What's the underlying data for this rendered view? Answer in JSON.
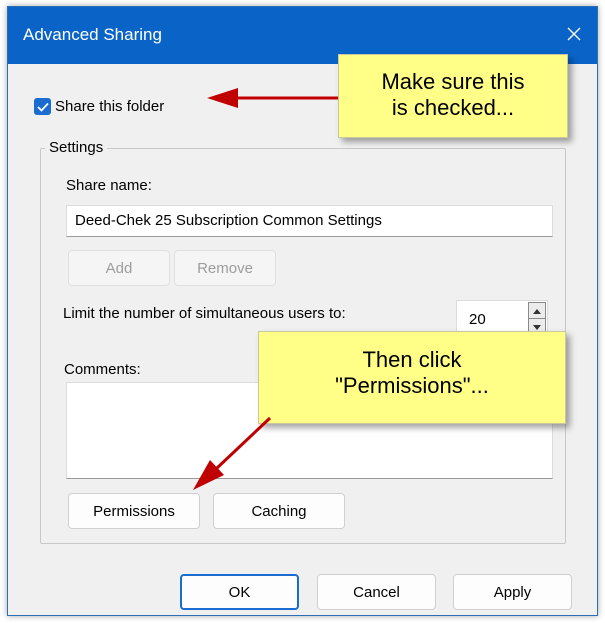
{
  "window": {
    "title": "Advanced Sharing"
  },
  "share": {
    "checkbox_label": "Share this folder",
    "checked": true
  },
  "settings": {
    "group_label": "Settings",
    "share_name_label": "Share name:",
    "share_name_value": "Deed-Chek 25 Subscription Common Settings",
    "add_label": "Add",
    "remove_label": "Remove",
    "limit_label": "Limit the number of simultaneous users to:",
    "limit_value": "20",
    "comments_label": "Comments:",
    "comments_value": "",
    "permissions_label": "Permissions",
    "caching_label": "Caching"
  },
  "footer": {
    "ok_label": "OK",
    "cancel_label": "Cancel",
    "apply_label": "Apply"
  },
  "callouts": {
    "first": {
      "line1": "Make sure this",
      "line2": "is checked..."
    },
    "second": {
      "line1": "Then click",
      "line2": "\"Permissions\"..."
    }
  },
  "colors": {
    "titlebar": "#0a64c8",
    "accent": "#1a6cd0",
    "callout_bg": "#ffff88",
    "arrow": "#c00000"
  },
  "icons": {
    "close": "close-icon",
    "check": "checkmark-icon",
    "spin_up": "spin-up-icon",
    "spin_down": "spin-down-icon"
  }
}
